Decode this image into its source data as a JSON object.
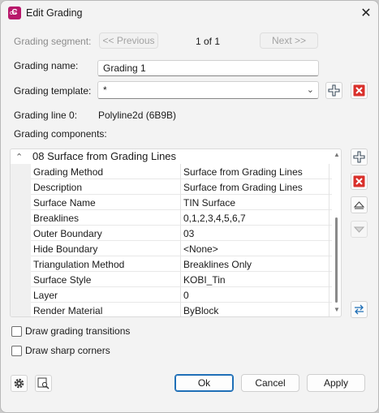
{
  "window": {
    "title": "Edit Grading",
    "app_icon_letter": "C",
    "app_icon_sub": "CIV"
  },
  "segment": {
    "label": "Grading segment:",
    "previous_label": "<< Previous",
    "counter": "1 of 1",
    "next_label": "Next >>"
  },
  "grading_name": {
    "label": "Grading name:",
    "value": "Grading 1"
  },
  "grading_template": {
    "label": "Grading template:",
    "value": "*"
  },
  "grading_line": {
    "label": "Grading line 0:",
    "value": "Polyline2d (6B9B)"
  },
  "components": {
    "label": "Grading components:",
    "category": "08 Surface from Grading Lines",
    "properties": [
      {
        "name": "Grading Method",
        "value": "Surface from Grading Lines"
      },
      {
        "name": "Description",
        "value": "Surface from Grading Lines"
      },
      {
        "name": "Surface Name",
        "value": "TIN Surface"
      },
      {
        "name": "Breaklines",
        "value": "0,1,2,3,4,5,6,7"
      },
      {
        "name": "Outer Boundary",
        "value": "03"
      },
      {
        "name": "Hide Boundary",
        "value": "<None>"
      },
      {
        "name": "Triangulation Method",
        "value": "Breaklines Only"
      },
      {
        "name": "Surface Style",
        "value": "KOBI_Tin"
      },
      {
        "name": "Layer",
        "value": "0"
      },
      {
        "name": "Render Material",
        "value": "ByBlock"
      }
    ]
  },
  "options": {
    "draw_transitions": {
      "label": "Draw grading transitions",
      "checked": false
    },
    "draw_sharp_corners": {
      "label": "Draw sharp corners",
      "checked": false
    }
  },
  "buttons": {
    "ok": "Ok",
    "cancel": "Cancel",
    "apply": "Apply"
  },
  "colors": {
    "delete_red": "#d9302b",
    "accent_blue": "#1f6fb7",
    "app_icon": "#b8186b"
  }
}
